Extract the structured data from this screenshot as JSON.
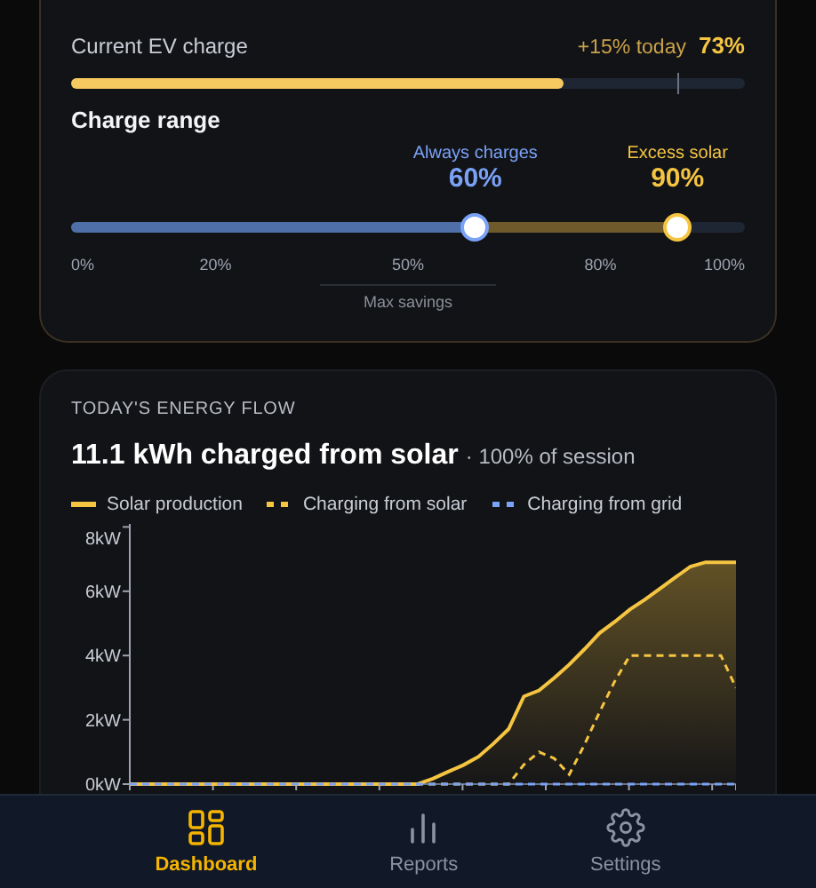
{
  "ev_charge": {
    "label": "Current EV charge",
    "delta": "+15% today",
    "value": "73%",
    "level": 0.73
  },
  "charge_range": {
    "title": "Charge range",
    "handles": [
      {
        "label": "Always charges",
        "value": "60%",
        "level": 0.6,
        "color": "#7aa2f7"
      },
      {
        "label": "Excess solar",
        "value": "90%",
        "level": 0.9,
        "color": "#f5c542"
      }
    ],
    "scale": [
      {
        "label": "0%",
        "level": 0
      },
      {
        "label": "20%",
        "level": 0.2
      },
      {
        "label": "50%",
        "level": 0.5
      },
      {
        "label": "80%",
        "level": 0.8
      },
      {
        "label": "100%",
        "level": 1
      }
    ],
    "note": "Max savings"
  },
  "energy_flow": {
    "title": "TODAY'S ENERGY FLOW",
    "headline": "11.1 kWh charged from solar",
    "subtitle": "· 100% of session",
    "chart_data": {
      "type": "line",
      "categories": [
        null,
        null,
        null,
        null,
        null,
        null,
        null,
        null,
        null,
        null,
        null,
        null,
        null,
        null,
        null,
        null,
        null,
        null,
        null,
        null,
        null,
        null,
        null,
        null,
        null,
        null,
        null,
        null,
        null,
        null,
        null,
        null,
        null,
        null,
        null,
        null,
        null,
        null,
        null,
        null,
        null
      ],
      "ylim": [
        0,
        8
      ],
      "yticks": [
        {
          "value": 0,
          "label": "0kW"
        },
        {
          "value": 2,
          "label": "2kW"
        },
        {
          "value": 4,
          "label": "4kW"
        },
        {
          "value": 6,
          "label": "6kW"
        },
        {
          "value": 8,
          "label": "8kW"
        }
      ],
      "series": [
        {
          "name": "Solar production",
          "color": "#f5c542",
          "type": "area",
          "line_style": "solid",
          "values": [
            0,
            0,
            0,
            0,
            0,
            0,
            0,
            0,
            0,
            0,
            0,
            0,
            0,
            0,
            0,
            0,
            0,
            0,
            0,
            0,
            0.17,
            0.38,
            0.59,
            0.85,
            1.26,
            1.71,
            2.73,
            2.91,
            3.3,
            3.72,
            4.2,
            4.7,
            5.05,
            5.43,
            5.74,
            6.09,
            6.43,
            6.77,
            6.9,
            6.9,
            6.9
          ]
        },
        {
          "name": "Charging from solar",
          "color": "#f5c542",
          "type": "line",
          "line_style": "dashed",
          "values": [
            0,
            0,
            0,
            0,
            0,
            0,
            0,
            0,
            0,
            0,
            0,
            0,
            0,
            0,
            0,
            0,
            0,
            0,
            0,
            0,
            0,
            0,
            0,
            0,
            0,
            0,
            0.61,
            1.0,
            0.8,
            0.3,
            1.23,
            2.25,
            3.2,
            4.0,
            4.0,
            4.0,
            4.0,
            4.0,
            4.0,
            4.0,
            3.0
          ]
        },
        {
          "name": "Charging from grid",
          "color": "#7aa2f7",
          "type": "line",
          "line_style": "dashed",
          "values": [
            0,
            0,
            0,
            0,
            0,
            0,
            0,
            0,
            0,
            0,
            0,
            0,
            0,
            0,
            0,
            0,
            0,
            0,
            0,
            0,
            0,
            0,
            0,
            0,
            0,
            0,
            0,
            0,
            0,
            0,
            0,
            0,
            0,
            0,
            0,
            0,
            0,
            0,
            0,
            0,
            0
          ]
        }
      ]
    }
  },
  "nav": [
    {
      "label": "Dashboard",
      "selected": true
    },
    {
      "label": "Reports",
      "selected": false
    },
    {
      "label": "Settings",
      "selected": false
    }
  ]
}
